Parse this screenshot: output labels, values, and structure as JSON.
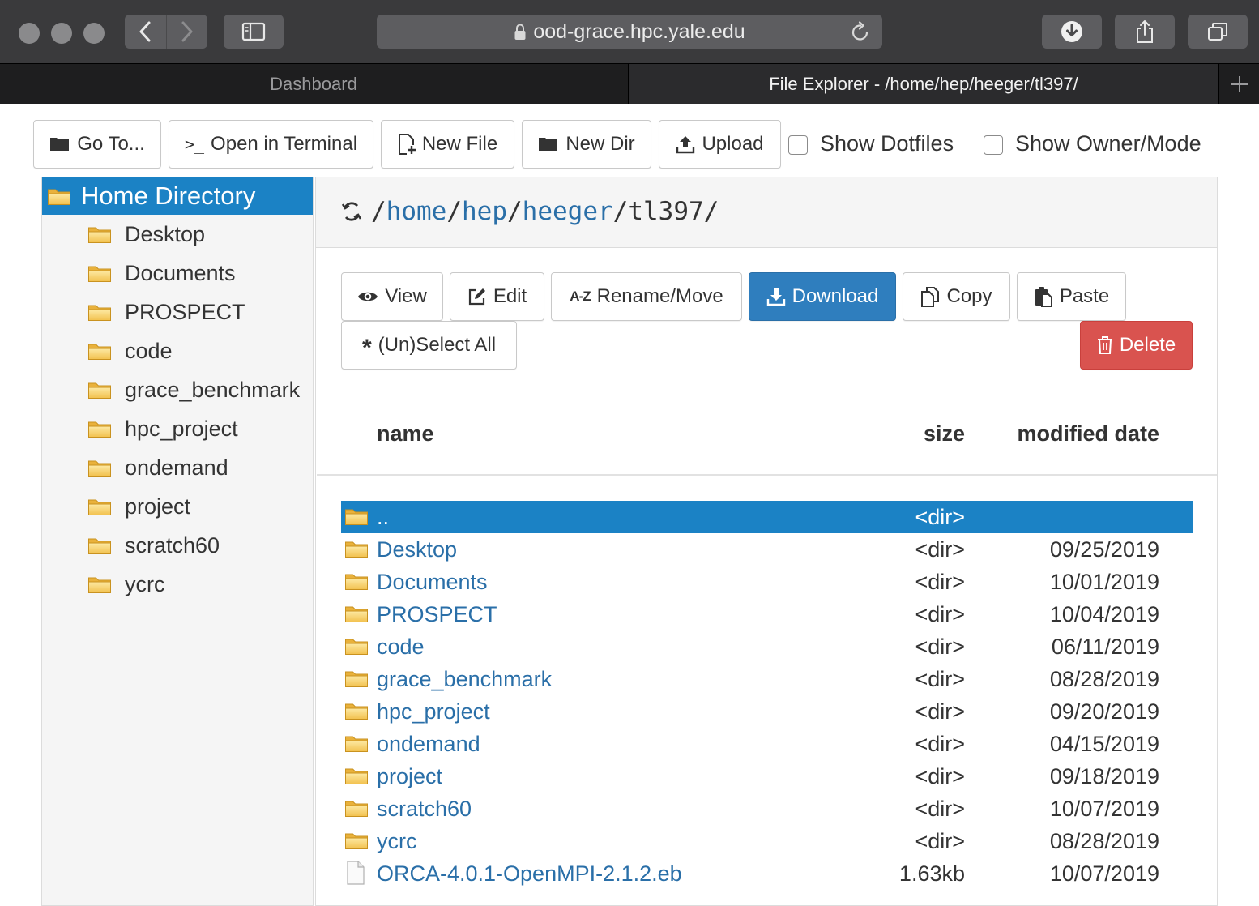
{
  "browser": {
    "url": "ood-grace.hpc.yale.edu",
    "tabs": [
      {
        "label": "Dashboard",
        "active": false
      },
      {
        "label": "File Explorer - /home/hep/heeger/tl397/",
        "active": true
      }
    ]
  },
  "toolbar": {
    "goto": "Go To...",
    "terminal": "Open in Terminal",
    "new_file": "New File",
    "new_dir": "New Dir",
    "upload": "Upload",
    "show_dotfiles": "Show Dotfiles",
    "show_owner": "Show Owner/Mode",
    "show_dotfiles_checked": false,
    "show_owner_checked": false
  },
  "sidebar": {
    "home": "Home Directory",
    "items": [
      "Desktop",
      "Documents",
      "PROSPECT",
      "code",
      "grace_benchmark",
      "hpc_project",
      "ondemand",
      "project",
      "scratch60",
      "ycrc"
    ]
  },
  "path": {
    "segments": [
      "home",
      "hep",
      "heeger",
      "tl397"
    ]
  },
  "actions": {
    "view": "View",
    "edit": "Edit",
    "rename": "Rename/Move",
    "download": "Download",
    "copy": "Copy",
    "paste": "Paste",
    "select_all": "(Un)Select All",
    "delete": "Delete"
  },
  "table": {
    "headers": {
      "name": "name",
      "size": "size",
      "modified": "modified date"
    },
    "rows": [
      {
        "name": "..",
        "size": "<dir>",
        "date": "",
        "type": "dir",
        "selected": true
      },
      {
        "name": "Desktop",
        "size": "<dir>",
        "date": "09/25/2019",
        "type": "dir"
      },
      {
        "name": "Documents",
        "size": "<dir>",
        "date": "10/01/2019",
        "type": "dir"
      },
      {
        "name": "PROSPECT",
        "size": "<dir>",
        "date": "10/04/2019",
        "type": "dir"
      },
      {
        "name": "code",
        "size": "<dir>",
        "date": "06/11/2019",
        "type": "dir"
      },
      {
        "name": "grace_benchmark",
        "size": "<dir>",
        "date": "08/28/2019",
        "type": "dir"
      },
      {
        "name": "hpc_project",
        "size": "<dir>",
        "date": "09/20/2019",
        "type": "dir"
      },
      {
        "name": "ondemand",
        "size": "<dir>",
        "date": "04/15/2019",
        "type": "dir"
      },
      {
        "name": "project",
        "size": "<dir>",
        "date": "09/18/2019",
        "type": "dir"
      },
      {
        "name": "scratch60",
        "size": "<dir>",
        "date": "10/07/2019",
        "type": "dir"
      },
      {
        "name": "ycrc",
        "size": "<dir>",
        "date": "08/28/2019",
        "type": "dir"
      },
      {
        "name": "ORCA-4.0.1-OpenMPI-2.1.2.eb",
        "size": "1.63kb",
        "date": "10/07/2019",
        "type": "file"
      }
    ]
  },
  "colors": {
    "accent": "#1b82c5",
    "link": "#2a6fa8",
    "danger": "#d9534f",
    "primary": "#2f7ebe"
  }
}
